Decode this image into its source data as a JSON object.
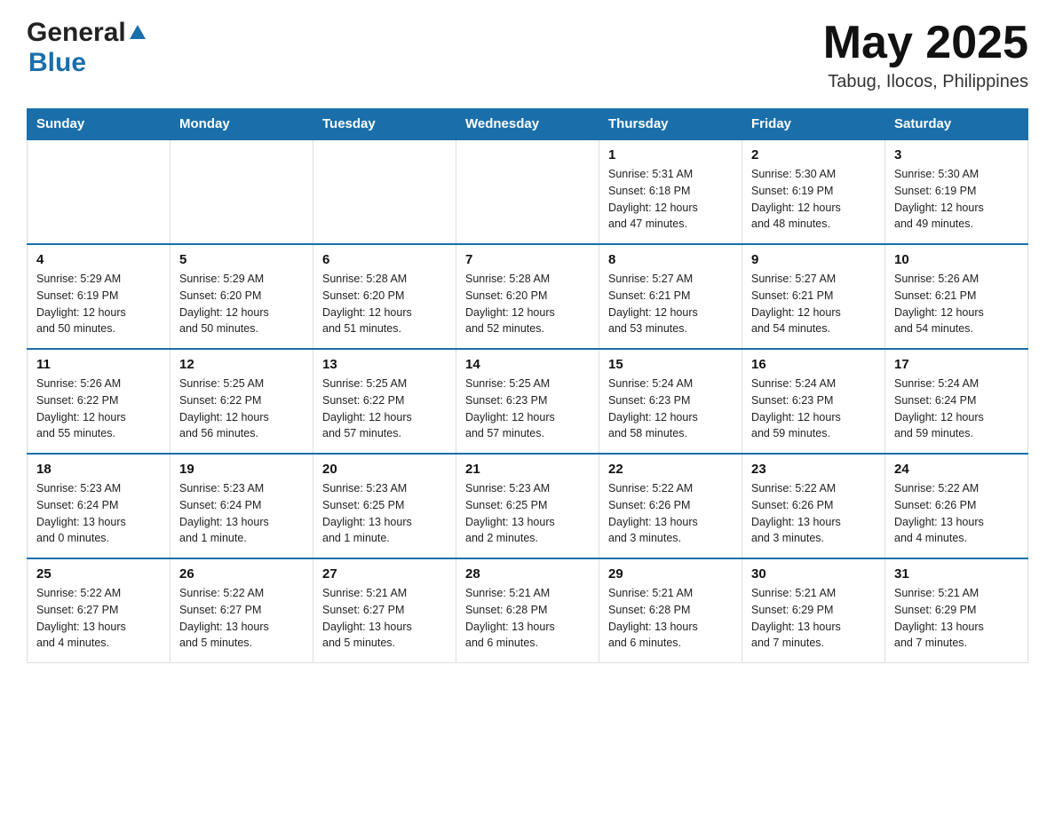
{
  "header": {
    "logo_general": "General",
    "logo_blue": "Blue",
    "title": "May 2025",
    "location": "Tabug, Ilocos, Philippines"
  },
  "weekdays": [
    "Sunday",
    "Monday",
    "Tuesday",
    "Wednesday",
    "Thursday",
    "Friday",
    "Saturday"
  ],
  "weeks": [
    [
      {
        "day": "",
        "info": ""
      },
      {
        "day": "",
        "info": ""
      },
      {
        "day": "",
        "info": ""
      },
      {
        "day": "",
        "info": ""
      },
      {
        "day": "1",
        "info": "Sunrise: 5:31 AM\nSunset: 6:18 PM\nDaylight: 12 hours\nand 47 minutes."
      },
      {
        "day": "2",
        "info": "Sunrise: 5:30 AM\nSunset: 6:19 PM\nDaylight: 12 hours\nand 48 minutes."
      },
      {
        "day": "3",
        "info": "Sunrise: 5:30 AM\nSunset: 6:19 PM\nDaylight: 12 hours\nand 49 minutes."
      }
    ],
    [
      {
        "day": "4",
        "info": "Sunrise: 5:29 AM\nSunset: 6:19 PM\nDaylight: 12 hours\nand 50 minutes."
      },
      {
        "day": "5",
        "info": "Sunrise: 5:29 AM\nSunset: 6:20 PM\nDaylight: 12 hours\nand 50 minutes."
      },
      {
        "day": "6",
        "info": "Sunrise: 5:28 AM\nSunset: 6:20 PM\nDaylight: 12 hours\nand 51 minutes."
      },
      {
        "day": "7",
        "info": "Sunrise: 5:28 AM\nSunset: 6:20 PM\nDaylight: 12 hours\nand 52 minutes."
      },
      {
        "day": "8",
        "info": "Sunrise: 5:27 AM\nSunset: 6:21 PM\nDaylight: 12 hours\nand 53 minutes."
      },
      {
        "day": "9",
        "info": "Sunrise: 5:27 AM\nSunset: 6:21 PM\nDaylight: 12 hours\nand 54 minutes."
      },
      {
        "day": "10",
        "info": "Sunrise: 5:26 AM\nSunset: 6:21 PM\nDaylight: 12 hours\nand 54 minutes."
      }
    ],
    [
      {
        "day": "11",
        "info": "Sunrise: 5:26 AM\nSunset: 6:22 PM\nDaylight: 12 hours\nand 55 minutes."
      },
      {
        "day": "12",
        "info": "Sunrise: 5:25 AM\nSunset: 6:22 PM\nDaylight: 12 hours\nand 56 minutes."
      },
      {
        "day": "13",
        "info": "Sunrise: 5:25 AM\nSunset: 6:22 PM\nDaylight: 12 hours\nand 57 minutes."
      },
      {
        "day": "14",
        "info": "Sunrise: 5:25 AM\nSunset: 6:23 PM\nDaylight: 12 hours\nand 57 minutes."
      },
      {
        "day": "15",
        "info": "Sunrise: 5:24 AM\nSunset: 6:23 PM\nDaylight: 12 hours\nand 58 minutes."
      },
      {
        "day": "16",
        "info": "Sunrise: 5:24 AM\nSunset: 6:23 PM\nDaylight: 12 hours\nand 59 minutes."
      },
      {
        "day": "17",
        "info": "Sunrise: 5:24 AM\nSunset: 6:24 PM\nDaylight: 12 hours\nand 59 minutes."
      }
    ],
    [
      {
        "day": "18",
        "info": "Sunrise: 5:23 AM\nSunset: 6:24 PM\nDaylight: 13 hours\nand 0 minutes."
      },
      {
        "day": "19",
        "info": "Sunrise: 5:23 AM\nSunset: 6:24 PM\nDaylight: 13 hours\nand 1 minute."
      },
      {
        "day": "20",
        "info": "Sunrise: 5:23 AM\nSunset: 6:25 PM\nDaylight: 13 hours\nand 1 minute."
      },
      {
        "day": "21",
        "info": "Sunrise: 5:23 AM\nSunset: 6:25 PM\nDaylight: 13 hours\nand 2 minutes."
      },
      {
        "day": "22",
        "info": "Sunrise: 5:22 AM\nSunset: 6:26 PM\nDaylight: 13 hours\nand 3 minutes."
      },
      {
        "day": "23",
        "info": "Sunrise: 5:22 AM\nSunset: 6:26 PM\nDaylight: 13 hours\nand 3 minutes."
      },
      {
        "day": "24",
        "info": "Sunrise: 5:22 AM\nSunset: 6:26 PM\nDaylight: 13 hours\nand 4 minutes."
      }
    ],
    [
      {
        "day": "25",
        "info": "Sunrise: 5:22 AM\nSunset: 6:27 PM\nDaylight: 13 hours\nand 4 minutes."
      },
      {
        "day": "26",
        "info": "Sunrise: 5:22 AM\nSunset: 6:27 PM\nDaylight: 13 hours\nand 5 minutes."
      },
      {
        "day": "27",
        "info": "Sunrise: 5:21 AM\nSunset: 6:27 PM\nDaylight: 13 hours\nand 5 minutes."
      },
      {
        "day": "28",
        "info": "Sunrise: 5:21 AM\nSunset: 6:28 PM\nDaylight: 13 hours\nand 6 minutes."
      },
      {
        "day": "29",
        "info": "Sunrise: 5:21 AM\nSunset: 6:28 PM\nDaylight: 13 hours\nand 6 minutes."
      },
      {
        "day": "30",
        "info": "Sunrise: 5:21 AM\nSunset: 6:29 PM\nDaylight: 13 hours\nand 7 minutes."
      },
      {
        "day": "31",
        "info": "Sunrise: 5:21 AM\nSunset: 6:29 PM\nDaylight: 13 hours\nand 7 minutes."
      }
    ]
  ]
}
